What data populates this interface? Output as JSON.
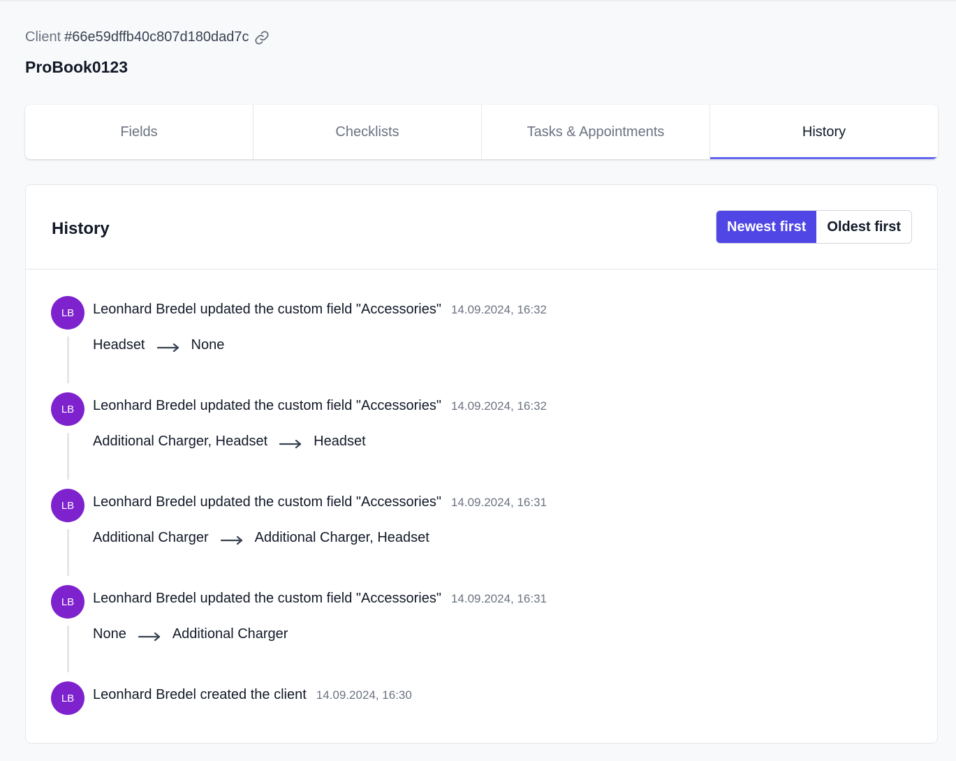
{
  "header": {
    "client_label": "Client",
    "client_id": "#66e59dffb40c807d180dad7c",
    "title": "ProBook0123"
  },
  "tabs": [
    {
      "label": "Fields",
      "active": false
    },
    {
      "label": "Checklists",
      "active": false
    },
    {
      "label": "Tasks & Appointments",
      "active": false
    },
    {
      "label": "History",
      "active": true
    }
  ],
  "history": {
    "title": "History",
    "sort": {
      "newest": "Newest first",
      "oldest": "Oldest first",
      "selected": "newest"
    },
    "entries": [
      {
        "initials": "LB",
        "text": "Leonhard Bredel updated the custom field \"Accessories\"",
        "time": "14.09.2024, 16:32",
        "from": "Headset",
        "to": "None"
      },
      {
        "initials": "LB",
        "text": "Leonhard Bredel updated the custom field \"Accessories\"",
        "time": "14.09.2024, 16:32",
        "from": "Additional Charger, Headset",
        "to": "Headset"
      },
      {
        "initials": "LB",
        "text": "Leonhard Bredel updated the custom field \"Accessories\"",
        "time": "14.09.2024, 16:31",
        "from": "Additional Charger",
        "to": "Additional Charger, Headset"
      },
      {
        "initials": "LB",
        "text": "Leonhard Bredel updated the custom field \"Accessories\"",
        "time": "14.09.2024, 16:31",
        "from": "None",
        "to": "Additional Charger"
      },
      {
        "initials": "LB",
        "text": "Leonhard Bredel created the client",
        "time": "14.09.2024, 16:30"
      }
    ]
  },
  "colors": {
    "accent": "#4f46e5",
    "tab_indicator": "#6366f1",
    "avatar": "#7e22ce"
  },
  "icons": {
    "copy_link": "link-icon",
    "change_arrow": "arrow-right-icon"
  }
}
